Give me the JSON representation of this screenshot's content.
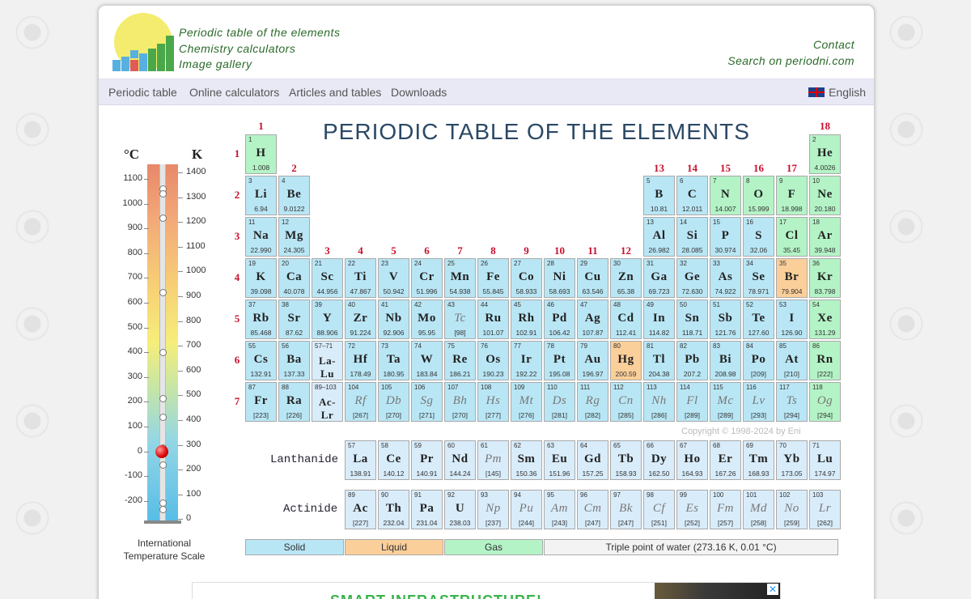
{
  "header": {
    "links_left": [
      "Periodic table of the elements",
      "Chemistry calculators",
      "Image gallery"
    ],
    "links_right": [
      "Contact",
      "Search on periodni.com"
    ]
  },
  "nav": {
    "items": [
      "Periodic table",
      "Online calculators",
      "Articles and tables",
      "Downloads"
    ],
    "language": "English"
  },
  "title": "PERIODIC TABLE OF THE ELEMENTS",
  "groups": [
    "1",
    "2",
    "3",
    "4",
    "5",
    "6",
    "7",
    "8",
    "9",
    "10",
    "11",
    "12",
    "13",
    "14",
    "15",
    "16",
    "17",
    "18"
  ],
  "periods": [
    "1",
    "2",
    "3",
    "4",
    "5",
    "6",
    "7"
  ],
  "elements": [
    [
      "1",
      "H",
      "1.008",
      "gas"
    ],
    [
      "2",
      "He",
      "4.0026",
      "gas"
    ],
    [
      "3",
      "Li",
      "6.94",
      "solid"
    ],
    [
      "4",
      "Be",
      "9.0122",
      "solid"
    ],
    [
      "5",
      "B",
      "10.81",
      "solid"
    ],
    [
      "6",
      "C",
      "12.011",
      "solid"
    ],
    [
      "7",
      "N",
      "14.007",
      "gas"
    ],
    [
      "8",
      "O",
      "15.999",
      "gas"
    ],
    [
      "9",
      "F",
      "18.998",
      "gas"
    ],
    [
      "10",
      "Ne",
      "20.180",
      "gas"
    ],
    [
      "11",
      "Na",
      "22.990",
      "solid"
    ],
    [
      "12",
      "Mg",
      "24.305",
      "solid"
    ],
    [
      "13",
      "Al",
      "26.982",
      "solid"
    ],
    [
      "14",
      "Si",
      "28.085",
      "solid"
    ],
    [
      "15",
      "P",
      "30.974",
      "solid"
    ],
    [
      "16",
      "S",
      "32.06",
      "solid"
    ],
    [
      "17",
      "Cl",
      "35.45",
      "gas"
    ],
    [
      "18",
      "Ar",
      "39.948",
      "gas"
    ],
    [
      "19",
      "K",
      "39.098",
      "solid"
    ],
    [
      "20",
      "Ca",
      "40.078",
      "solid"
    ],
    [
      "21",
      "Sc",
      "44.956",
      "solid"
    ],
    [
      "22",
      "Ti",
      "47.867",
      "solid"
    ],
    [
      "23",
      "V",
      "50.942",
      "solid"
    ],
    [
      "24",
      "Cr",
      "51.996",
      "solid"
    ],
    [
      "25",
      "Mn",
      "54.938",
      "solid"
    ],
    [
      "26",
      "Fe",
      "55.845",
      "solid"
    ],
    [
      "27",
      "Co",
      "58.933",
      "solid"
    ],
    [
      "28",
      "Ni",
      "58.693",
      "solid"
    ],
    [
      "29",
      "Cu",
      "63.546",
      "solid"
    ],
    [
      "30",
      "Zn",
      "65.38",
      "solid"
    ],
    [
      "31",
      "Ga",
      "69.723",
      "solid"
    ],
    [
      "32",
      "Ge",
      "72.630",
      "solid"
    ],
    [
      "33",
      "As",
      "74.922",
      "solid"
    ],
    [
      "34",
      "Se",
      "78.971",
      "solid"
    ],
    [
      "35",
      "Br",
      "79.904",
      "liquid"
    ],
    [
      "36",
      "Kr",
      "83.798",
      "gas"
    ],
    [
      "37",
      "Rb",
      "85.468",
      "solid"
    ],
    [
      "38",
      "Sr",
      "87.62",
      "solid"
    ],
    [
      "39",
      "Y",
      "88.906",
      "solid"
    ],
    [
      "40",
      "Zr",
      "91.224",
      "solid"
    ],
    [
      "41",
      "Nb",
      "92.906",
      "solid"
    ],
    [
      "42",
      "Mo",
      "95.95",
      "solid"
    ],
    [
      "43",
      "Tc",
      "[98]",
      "solid syn"
    ],
    [
      "44",
      "Ru",
      "101.07",
      "solid"
    ],
    [
      "45",
      "Rh",
      "102.91",
      "solid"
    ],
    [
      "46",
      "Pd",
      "106.42",
      "solid"
    ],
    [
      "47",
      "Ag",
      "107.87",
      "solid"
    ],
    [
      "48",
      "Cd",
      "112.41",
      "solid"
    ],
    [
      "49",
      "In",
      "114.82",
      "solid"
    ],
    [
      "50",
      "Sn",
      "118.71",
      "solid"
    ],
    [
      "51",
      "Sb",
      "121.76",
      "solid"
    ],
    [
      "52",
      "Te",
      "127.60",
      "solid"
    ],
    [
      "53",
      "I",
      "126.90",
      "solid"
    ],
    [
      "54",
      "Xe",
      "131.29",
      "gas"
    ],
    [
      "55",
      "Cs",
      "132.91",
      "solid"
    ],
    [
      "56",
      "Ba",
      "137.33",
      "solid"
    ],
    [
      "57–71",
      "La-Lu",
      "",
      "ln"
    ],
    [
      "72",
      "Hf",
      "178.49",
      "solid"
    ],
    [
      "73",
      "Ta",
      "180.95",
      "solid"
    ],
    [
      "74",
      "W",
      "183.84",
      "solid"
    ],
    [
      "75",
      "Re",
      "186.21",
      "solid"
    ],
    [
      "76",
      "Os",
      "190.23",
      "solid"
    ],
    [
      "77",
      "Ir",
      "192.22",
      "solid"
    ],
    [
      "78",
      "Pt",
      "195.08",
      "solid"
    ],
    [
      "79",
      "Au",
      "196.97",
      "solid"
    ],
    [
      "80",
      "Hg",
      "200.59",
      "liquid"
    ],
    [
      "81",
      "Tl",
      "204.38",
      "solid"
    ],
    [
      "82",
      "Pb",
      "207.2",
      "solid"
    ],
    [
      "83",
      "Bi",
      "208.98",
      "solid"
    ],
    [
      "84",
      "Po",
      "[209]",
      "solid"
    ],
    [
      "85",
      "At",
      "[210]",
      "solid"
    ],
    [
      "86",
      "Rn",
      "[222]",
      "gas"
    ],
    [
      "87",
      "Fr",
      "[223]",
      "solid"
    ],
    [
      "88",
      "Ra",
      "[226]",
      "solid"
    ],
    [
      "89–103",
      "Ac-Lr",
      "",
      "ln"
    ],
    [
      "104",
      "Rf",
      "[267]",
      "solid syn"
    ],
    [
      "105",
      "Db",
      "[270]",
      "solid syn"
    ],
    [
      "106",
      "Sg",
      "[271]",
      "solid syn"
    ],
    [
      "107",
      "Bh",
      "[270]",
      "solid syn"
    ],
    [
      "108",
      "Hs",
      "[277]",
      "solid syn"
    ],
    [
      "109",
      "Mt",
      "[276]",
      "solid syn"
    ],
    [
      "110",
      "Ds",
      "[281]",
      "solid syn"
    ],
    [
      "111",
      "Rg",
      "[282]",
      "solid syn"
    ],
    [
      "112",
      "Cn",
      "[285]",
      "solid syn"
    ],
    [
      "113",
      "Nh",
      "[286]",
      "solid syn"
    ],
    [
      "114",
      "Fl",
      "[289]",
      "solid syn"
    ],
    [
      "115",
      "Mc",
      "[289]",
      "solid syn"
    ],
    [
      "116",
      "Lv",
      "[293]",
      "solid syn"
    ],
    [
      "117",
      "Ts",
      "[294]",
      "solid syn"
    ],
    [
      "118",
      "Og",
      "[294]",
      "gas syn"
    ]
  ],
  "lanthanides": [
    [
      "57",
      "La",
      "138.91"
    ],
    [
      "58",
      "Ce",
      "140.12"
    ],
    [
      "59",
      "Pr",
      "140.91"
    ],
    [
      "60",
      "Nd",
      "144.24"
    ],
    [
      "61",
      "Pm",
      "[145]"
    ],
    [
      "62",
      "Sm",
      "150.36"
    ],
    [
      "63",
      "Eu",
      "151.96"
    ],
    [
      "64",
      "Gd",
      "157.25"
    ],
    [
      "65",
      "Tb",
      "158.93"
    ],
    [
      "66",
      "Dy",
      "162.50"
    ],
    [
      "67",
      "Ho",
      "164.93"
    ],
    [
      "68",
      "Er",
      "167.26"
    ],
    [
      "69",
      "Tm",
      "168.93"
    ],
    [
      "70",
      "Yb",
      "173.05"
    ],
    [
      "71",
      "Lu",
      "174.97"
    ]
  ],
  "actinides": [
    [
      "89",
      "Ac",
      "[227]"
    ],
    [
      "90",
      "Th",
      "232.04"
    ],
    [
      "91",
      "Pa",
      "231.04"
    ],
    [
      "92",
      "U",
      "238.03"
    ],
    [
      "93",
      "Np",
      "[237]"
    ],
    [
      "94",
      "Pu",
      "[244]"
    ],
    [
      "95",
      "Am",
      "[243]"
    ],
    [
      "96",
      "Cm",
      "[247]"
    ],
    [
      "97",
      "Bk",
      "[247]"
    ],
    [
      "98",
      "Cf",
      "[251]"
    ],
    [
      "99",
      "Es",
      "[252]"
    ],
    [
      "100",
      "Fm",
      "[257]"
    ],
    [
      "101",
      "Md",
      "[258]"
    ],
    [
      "102",
      "No",
      "[259]"
    ],
    [
      "103",
      "Lr",
      "[262]"
    ]
  ],
  "labels": {
    "lanthanide": "Lanthanide",
    "actinide": "Actinide",
    "copyright": "Copyright © 1998-2024 by Eni"
  },
  "legend": [
    "Solid",
    "Liquid",
    "Gas",
    "Triple point of water (273.16 K, 0.01 °C)"
  ],
  "thermometer": {
    "celsius_label": "°C",
    "kelvin_label": "K",
    "celsius_ticks": [
      "1100",
      "1000",
      "900",
      "800",
      "700",
      "600",
      "500",
      "400",
      "300",
      "200",
      "100",
      "0",
      "-100",
      "-200"
    ],
    "kelvin_ticks": [
      "1400",
      "1300",
      "1200",
      "1100",
      "1000",
      "900",
      "800",
      "700",
      "600",
      "500",
      "400",
      "300",
      "200",
      "100",
      "0"
    ],
    "scale_name": "International Temperature Scale"
  },
  "ad": {
    "text": "SMART INFRASTRUCTURE!"
  }
}
